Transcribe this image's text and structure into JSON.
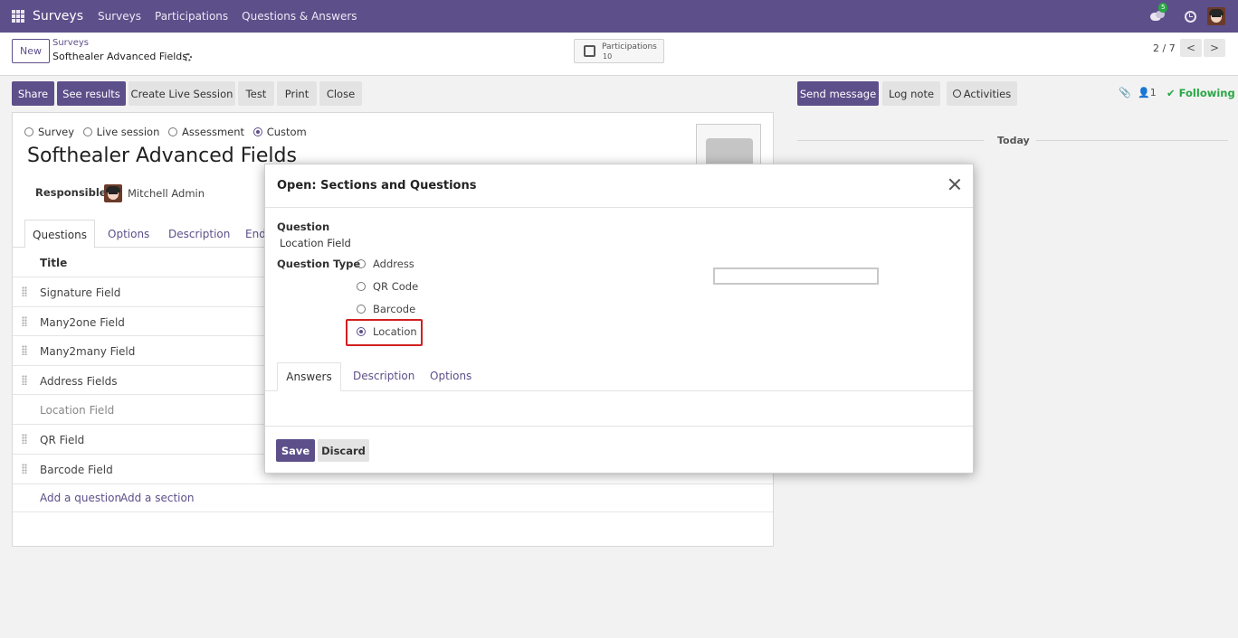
{
  "topbar": {
    "app_name": "Surveys",
    "menu": [
      "Surveys",
      "Participations",
      "Questions & Answers"
    ],
    "chat_badge": "5"
  },
  "breadcrumb": {
    "new_label": "New",
    "parent": "Surveys",
    "current": "Softhealer Advanced Fields"
  },
  "participations": {
    "label": "Participations",
    "count": "10"
  },
  "pager": {
    "text": "2 / 7",
    "prev": "<",
    "next": ">"
  },
  "actions": {
    "share": "Share",
    "see_results": "See results",
    "create_live_session": "Create Live Session",
    "test": "Test",
    "print": "Print",
    "close": "Close"
  },
  "chatter": {
    "send_message": "Send message",
    "log_note": "Log note",
    "activities": "Activities",
    "followers": "1",
    "following": "Following",
    "today": "Today"
  },
  "form": {
    "survey_types": [
      "Survey",
      "Live session",
      "Assessment",
      "Custom"
    ],
    "selected_type": "Custom",
    "title": "Softhealer Advanced Fields",
    "responsible_label": "Responsible",
    "responsible_name": "Mitchell Admin",
    "tabs": [
      "Questions",
      "Options",
      "Description",
      "End"
    ],
    "column_title": "Title",
    "rows": [
      "Signature Field",
      "Many2one Field",
      "Many2many Field",
      "Address Fields",
      "Location Field",
      "QR Field",
      "Barcode Field"
    ],
    "add_question": "Add a question",
    "add_section": "Add a section"
  },
  "modal": {
    "title": "Open: Sections and Questions",
    "question_label": "Question",
    "question_value": "Location Field",
    "type_label": "Question Type",
    "type_options": [
      "Address",
      "QR Code",
      "Barcode",
      "Location"
    ],
    "selected_option": "Location",
    "tabs": [
      "Answers",
      "Description",
      "Options"
    ],
    "save": "Save",
    "discard": "Discard"
  },
  "colors": {
    "brand": "#5d4f8a",
    "following": "#28a745",
    "highlight": "#d31f1f"
  }
}
